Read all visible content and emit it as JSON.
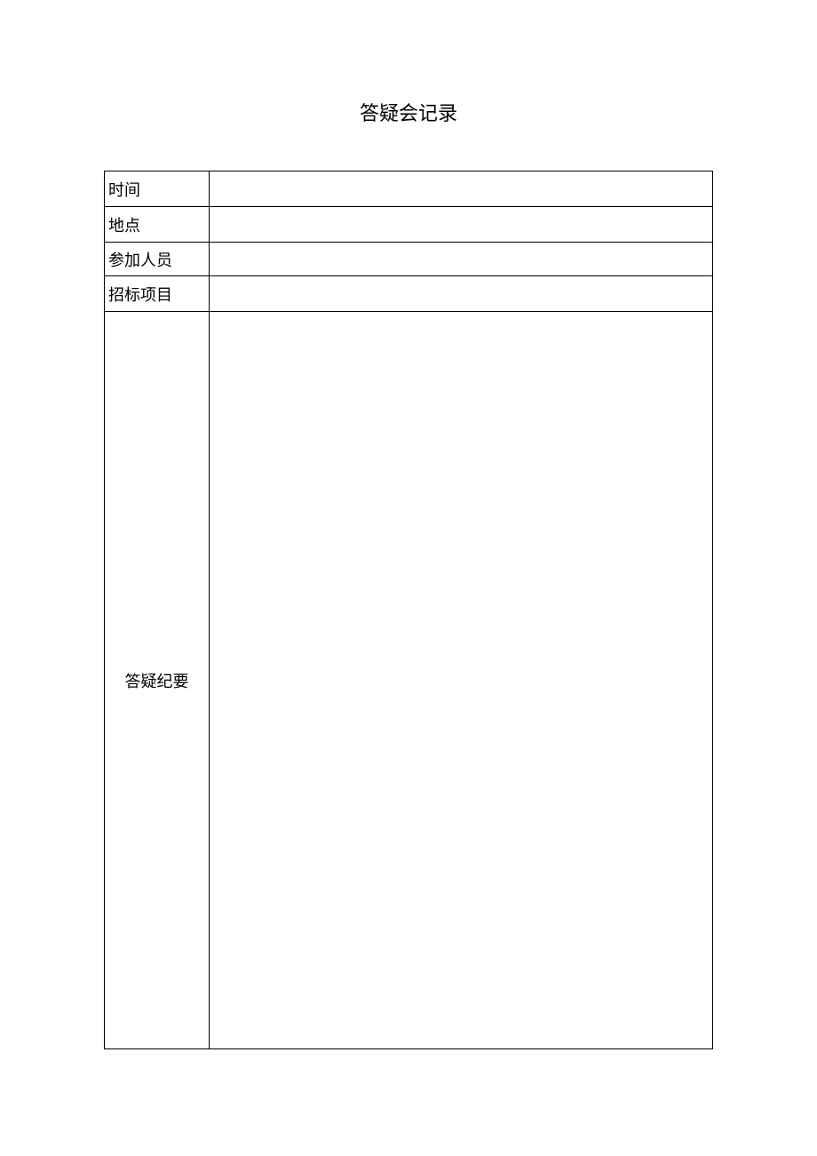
{
  "title": "答疑会记录",
  "fields": {
    "time": {
      "label": "时间",
      "value": ""
    },
    "location": {
      "label": "地点",
      "value": ""
    },
    "participants": {
      "label": "参加人员",
      "value": ""
    },
    "project": {
      "label": "招标项目",
      "value": ""
    },
    "summary": {
      "label": "答疑纪要",
      "value": ""
    }
  }
}
